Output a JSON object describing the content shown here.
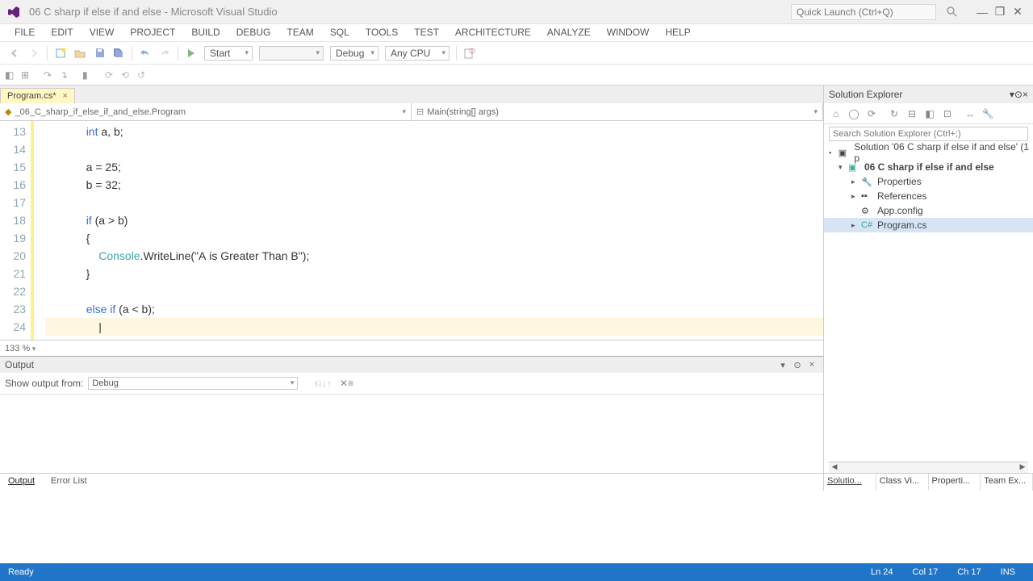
{
  "title": "06 C sharp if else if and else - Microsoft Visual Studio",
  "quick_launch_placeholder": "Quick Launch (Ctrl+Q)",
  "menu": {
    "items": [
      "FILE",
      "EDIT",
      "VIEW",
      "PROJECT",
      "BUILD",
      "DEBUG",
      "TEAM",
      "SQL",
      "TOOLS",
      "TEST",
      "ARCHITECTURE",
      "ANALYZE",
      "WINDOW",
      "HELP"
    ]
  },
  "toolbar": {
    "start_label": "Start",
    "config": "Debug",
    "platform": "Any CPU"
  },
  "doc_tab": {
    "name": "Program.cs*"
  },
  "nav": {
    "left": "_06_C_sharp_if_else_if_and_else.Program",
    "right": "Main(string[] args)"
  },
  "code": {
    "first_line": 13,
    "lines": [
      {
        "t": "            int a, b;",
        "kw": [
          "int"
        ]
      },
      {
        "t": ""
      },
      {
        "t": "            a = 25;"
      },
      {
        "t": "            b = 32;"
      },
      {
        "t": ""
      },
      {
        "t": "            if (a > b)",
        "kw": [
          "if"
        ]
      },
      {
        "t": "            {"
      },
      {
        "t": "                Console.WriteLine(\"A is Greater Than B\");",
        "cls": [
          "Console"
        ],
        "str": "\"A is Greater Than B\""
      },
      {
        "t": "            }"
      },
      {
        "t": ""
      },
      {
        "t": "            else if (a < b);",
        "kw": [
          "else",
          "if"
        ]
      },
      {
        "t": "                |",
        "hl": true
      },
      {
        "t": "        }"
      },
      {
        "t": "    }"
      },
      {
        "t": "}"
      }
    ]
  },
  "zoom": "133 %",
  "output": {
    "title": "Output",
    "show_label": "Show output from:",
    "source": "Debug"
  },
  "bottom_tabs": {
    "items": [
      "Output",
      "Error List"
    ],
    "active": 0
  },
  "solution_explorer": {
    "title": "Solution Explorer",
    "search_placeholder": "Search Solution Explorer (Ctrl+;)",
    "solution": "Solution '06 C sharp if else if and else' (1 p",
    "project": "06 C sharp if else if and else",
    "nodes": [
      "Properties",
      "References",
      "App.config",
      "Program.cs"
    ],
    "selected": "Program.cs"
  },
  "right_tabs": [
    "Solutio...",
    "Class Vi...",
    "Properti...",
    "Team Ex..."
  ],
  "status": {
    "ready": "Ready",
    "ln": "Ln 24",
    "col": "Col 17",
    "ch": "Ch 17",
    "ins": "INS"
  }
}
